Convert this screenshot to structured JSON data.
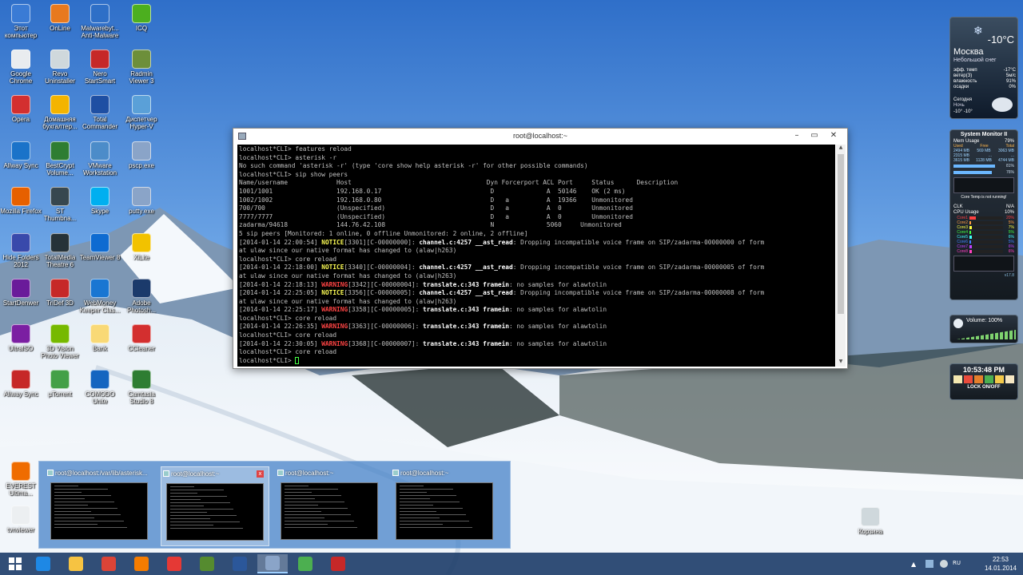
{
  "desktop": {
    "icons": [
      {
        "label": "Этот компьютер",
        "icon": "computer-icon",
        "color": "#3a7bd5"
      },
      {
        "label": "OnLine",
        "icon": "online-icon",
        "color": "#e8791e"
      },
      {
        "label": "Malwarebyt... Anti-Malware",
        "icon": "malwarebytes-icon",
        "color": "#2e6fc7"
      },
      {
        "label": "ICQ",
        "icon": "icq-icon",
        "color": "#4caf1f"
      },
      {
        "label": "Google Chrome",
        "icon": "chrome-icon",
        "color": "#e9ecef"
      },
      {
        "label": "Revo Uninstaller",
        "icon": "revo-icon",
        "color": "#cfd8dc"
      },
      {
        "label": "Nero StartSmart",
        "icon": "nero-icon",
        "color": "#c62828"
      },
      {
        "label": "Radmin Viewer 3",
        "icon": "radmin-icon",
        "color": "#6d8f3a"
      },
      {
        "label": "Opera",
        "icon": "opera-icon",
        "color": "#d32f2f"
      },
      {
        "label": "Домашняя бухгалтер...",
        "icon": "accounting-icon",
        "color": "#f4b400"
      },
      {
        "label": "Total Commander",
        "icon": "total-commander-icon",
        "color": "#1e4fa3"
      },
      {
        "label": "Диспетчер Hyper-V",
        "icon": "hyperv-icon",
        "color": "#5aa0d8"
      },
      {
        "label": "Allway Sync",
        "icon": "allway-sync-icon",
        "color": "#1a73c9"
      },
      {
        "label": "BestCrypt Volume...",
        "icon": "bestcrypt-icon",
        "color": "#2e7d32"
      },
      {
        "label": "VMware Workstation",
        "icon": "vmware-icon",
        "color": "#4c8cc9"
      },
      {
        "label": "pscp.exe",
        "icon": "pscp-icon",
        "color": "#8aa4c8"
      },
      {
        "label": "Mozilla Firefox",
        "icon": "firefox-icon",
        "color": "#e66000"
      },
      {
        "label": "ST Thumbna...",
        "icon": "st-thumbnails-icon",
        "color": "#37474f"
      },
      {
        "label": "Skype",
        "icon": "skype-icon",
        "color": "#00aff0"
      },
      {
        "label": "putty.exe",
        "icon": "putty-icon",
        "color": "#8aa4c8"
      },
      {
        "label": "Hide Folders 2012",
        "icon": "hide-folders-icon",
        "color": "#3949ab"
      },
      {
        "label": "TotalMedia Theatre 6",
        "icon": "totalmedia-icon",
        "color": "#263238"
      },
      {
        "label": "TeamViewer 8",
        "icon": "teamviewer-icon",
        "color": "#0e6bd1"
      },
      {
        "label": "XiLite",
        "icon": "xilite-icon",
        "color": "#f2c200"
      },
      {
        "label": "StartDenwer",
        "icon": "denwer-icon",
        "color": "#6a1b9a"
      },
      {
        "label": "TriDef 3D",
        "icon": "tridef-icon",
        "color": "#c62828"
      },
      {
        "label": "WebMoney Keeper Clas...",
        "icon": "webmoney-icon",
        "color": "#1976d2"
      },
      {
        "label": "Adobe Photosh...",
        "icon": "photoshop-icon",
        "color": "#1b3a6b"
      },
      {
        "label": "UltraISO",
        "icon": "ultraiso-icon",
        "color": "#7b1fa2"
      },
      {
        "label": "3D Vision Photo Viewer",
        "icon": "3dvision-icon",
        "color": "#76b900"
      },
      {
        "label": "Bank",
        "icon": "bank-icon",
        "color": "#f9d976"
      },
      {
        "label": "CCleaner",
        "icon": "ccleaner-icon",
        "color": "#d32f2f"
      },
      {
        "label": "Allway Sync",
        "icon": "allway-sync-icon",
        "color": "#c62828"
      },
      {
        "label": "µTorrent",
        "icon": "utorrent-icon",
        "color": "#43a047"
      },
      {
        "label": "COMODO Unite",
        "icon": "comodo-icon",
        "color": "#1565c0"
      },
      {
        "label": "Camtasia Studio 8",
        "icon": "camtasia-icon",
        "color": "#2e7d32"
      },
      {
        "label": "EVEREST Ultima...",
        "icon": "everest-icon",
        "color": "#ef6c00"
      },
      {
        "label": "tvnviewer",
        "icon": "tvnviewer-icon",
        "color": "#eceff1"
      },
      {
        "label": "Корзина",
        "icon": "recycle-bin-icon",
        "color": "#cfd8dc"
      }
    ]
  },
  "putty": {
    "title": "root@localhost:~",
    "lines": [
      [
        {
          "t": "localhost*CLI> features reload"
        }
      ],
      [
        {
          "t": "localhost*CLI> asterisk -r"
        }
      ],
      [
        {
          "t": "No such command 'asterisk -r' (type 'core show help asterisk -r' for other possible commands)"
        }
      ],
      [
        {
          "t": "localhost*CLI> sip show peers"
        }
      ],
      [
        {
          "t": "Name/username             Host                                    Dyn Forcerport ACL Port     Status      Description"
        }
      ],
      [
        {
          "t": "1001/1001                 192.168.0.17                             D              A  50146    OK (2 ms)"
        }
      ],
      [
        {
          "t": "1002/1002                 192.168.0.80                             D   a          A  19366    Unmonitored"
        }
      ],
      [
        {
          "t": "700/700                   (Unspecified)                            D   a          A  0        Unmonitored"
        }
      ],
      [
        {
          "t": "7777/7777                 (Unspecified)                            D   a          A  0        Unmonitored"
        }
      ],
      [
        {
          "t": "zadarma/94618             144.76.42.108                            N              5060     Unmonitored"
        }
      ],
      [
        {
          "t": "5 sip peers [Monitored: 1 online, 0 offline Unmonitored: 2 online, 2 offline]"
        }
      ],
      [
        {
          "t": "[2014-01-14 22:00:54] "
        },
        {
          "t": "NOTICE",
          "c": "y"
        },
        {
          "t": "[3301][C-00000000]: "
        },
        {
          "t": "channel.c:4257 __ast_read",
          "c": "b"
        },
        {
          "t": ": Dropping incompatible voice frame on SIP/zadarma-00000000 of form"
        }
      ],
      [
        {
          "t": "at ulaw since our native format has changed to (alaw|h263)"
        }
      ],
      [
        {
          "t": "localhost*CLI> core reload"
        }
      ],
      [
        {
          "t": "[2014-01-14 22:18:00] "
        },
        {
          "t": "NOTICE",
          "c": "y"
        },
        {
          "t": "[3340][C-00000004]: "
        },
        {
          "t": "channel.c:4257 __ast_read",
          "c": "b"
        },
        {
          "t": ": Dropping incompatible voice frame on SIP/zadarma-00000005 of form"
        }
      ],
      [
        {
          "t": "at ulaw since our native format has changed to (alaw|h263)"
        }
      ],
      [
        {
          "t": "[2014-01-14 22:18:13] "
        },
        {
          "t": "WARNING",
          "c": "r"
        },
        {
          "t": "[3342][C-00000004]: "
        },
        {
          "t": "translate.c:343 framein",
          "c": "b"
        },
        {
          "t": ": no samples for alawtolin"
        }
      ],
      [
        {
          "t": "[2014-01-14 22:25:05] "
        },
        {
          "t": "NOTICE",
          "c": "y"
        },
        {
          "t": "[3356][C-00000005]: "
        },
        {
          "t": "channel.c:4257 __ast_read",
          "c": "b"
        },
        {
          "t": ": Dropping incompatible voice frame on SIP/zadarma-00000008 of form"
        }
      ],
      [
        {
          "t": "at ulaw since our native format has changed to (alaw|h263)"
        }
      ],
      [
        {
          "t": "[2014-01-14 22:25:17] "
        },
        {
          "t": "WARNING",
          "c": "r"
        },
        {
          "t": "[3358][C-00000005]: "
        },
        {
          "t": "translate.c:343 framein",
          "c": "b"
        },
        {
          "t": ": no samples for alawtolin"
        }
      ],
      [
        {
          "t": "localhost*CLI> core reload"
        }
      ],
      [
        {
          "t": "[2014-01-14 22:26:35] "
        },
        {
          "t": "WARNING",
          "c": "r"
        },
        {
          "t": "[3363][C-00000006]: "
        },
        {
          "t": "translate.c:343 framein",
          "c": "b"
        },
        {
          "t": ": no samples for alawtolin"
        }
      ],
      [
        {
          "t": "localhost*CLI> core reload"
        }
      ],
      [
        {
          "t": "[2014-01-14 22:30:05] "
        },
        {
          "t": "WARNING",
          "c": "r"
        },
        {
          "t": "[3368][C-00000007]: "
        },
        {
          "t": "translate.c:343 framein",
          "c": "b"
        },
        {
          "t": ": no samples for alawtolin"
        }
      ],
      [
        {
          "t": "localhost*CLI> core reload"
        }
      ],
      [
        {
          "t": "localhost*CLI> "
        }
      ]
    ]
  },
  "task_preview": {
    "items": [
      {
        "title": "root@localhost:/var/lib/asterisk...",
        "selected": false
      },
      {
        "title": "root@localhost:~",
        "selected": true,
        "close": "x"
      },
      {
        "title": "root@localhost:~",
        "selected": false
      },
      {
        "title": "root@localhost:~",
        "selected": false
      }
    ]
  },
  "taskbar": {
    "apps": [
      {
        "icon": "internet-explorer-icon",
        "color": "#1e88e5"
      },
      {
        "icon": "file-explorer-icon",
        "color": "#f6c342"
      },
      {
        "icon": "chrome-icon",
        "color": "#db4437"
      },
      {
        "icon": "media-player-icon",
        "color": "#f57c00"
      },
      {
        "icon": "xilite-icon",
        "color": "#e53935"
      },
      {
        "icon": "camtasia-icon",
        "color": "#558b2f"
      },
      {
        "icon": "word-icon",
        "color": "#2b579a"
      },
      {
        "icon": "putty-icon",
        "color": "#8aa4c8",
        "active": true
      },
      {
        "icon": "hyperv-icon",
        "color": "#4caf50"
      },
      {
        "icon": "allway-sync-icon",
        "color": "#c62828"
      }
    ],
    "clock_time": "22:53",
    "clock_date": "14.01.2014"
  },
  "weather": {
    "temp": "-10°C",
    "city": "Москва",
    "condition": "Небольшой снег",
    "rows": [
      {
        "k": "эфф. темп",
        "v": "-17°C"
      },
      {
        "k": "ветер(З)",
        "v": "5м/с"
      },
      {
        "k": "влажность",
        "v": "91%"
      },
      {
        "k": "осадки",
        "v": "0%"
      }
    ],
    "today_label": "Сегодня",
    "night_label": "Ночь",
    "today_range": "-10°  -10°"
  },
  "sysmon": {
    "title": "System Monitor II",
    "mem_label": "Mem Usage",
    "mem_pct": "79%",
    "mem_rows": [
      {
        "a": "Used",
        "b": "Free",
        "c": "Total"
      },
      {
        "a": "2494 MB",
        "b": "569 MB",
        "c": "3063 MB"
      },
      {
        "a": "2315 MB",
        "b": "...",
        "c": "..."
      },
      {
        "a": "3615 MB",
        "b": "1128 MB",
        "c": "4744 MB"
      }
    ],
    "ram_pct": "81%",
    "all_pct": "76%",
    "core_temp_text": "Core Temp is not running!",
    "clk_label": "CLK",
    "clk_value": "N/A",
    "cpu_label": "CPU Usage",
    "cpu_pct": "10%",
    "cores": [
      {
        "name": "Core1",
        "pct": "20%",
        "level": 0.2,
        "color": "#ff4040"
      },
      {
        "name": "Core2",
        "pct": "5%",
        "level": 0.05,
        "color": "#ff9d40"
      },
      {
        "name": "Core3",
        "pct": "7%",
        "level": 0.07,
        "color": "#ffff40"
      },
      {
        "name": "Core4",
        "pct": "5%",
        "level": 0.05,
        "color": "#40ff40"
      },
      {
        "name": "Core5",
        "pct": "6%",
        "level": 0.06,
        "color": "#40ffff"
      },
      {
        "name": "Core6",
        "pct": "5%",
        "level": 0.05,
        "color": "#4080ff"
      },
      {
        "name": "Core7",
        "pct": "6%",
        "level": 0.06,
        "color": "#c040ff"
      },
      {
        "name": "Core8",
        "pct": "6%",
        "level": 0.06,
        "color": "#ff40c0"
      }
    ],
    "footer": "v17.8"
  },
  "volume": {
    "label": "Volume: 100%"
  },
  "clock_gadget": {
    "time": "10:53:48 PM",
    "lock_label": "LOCK ON/OFF"
  }
}
